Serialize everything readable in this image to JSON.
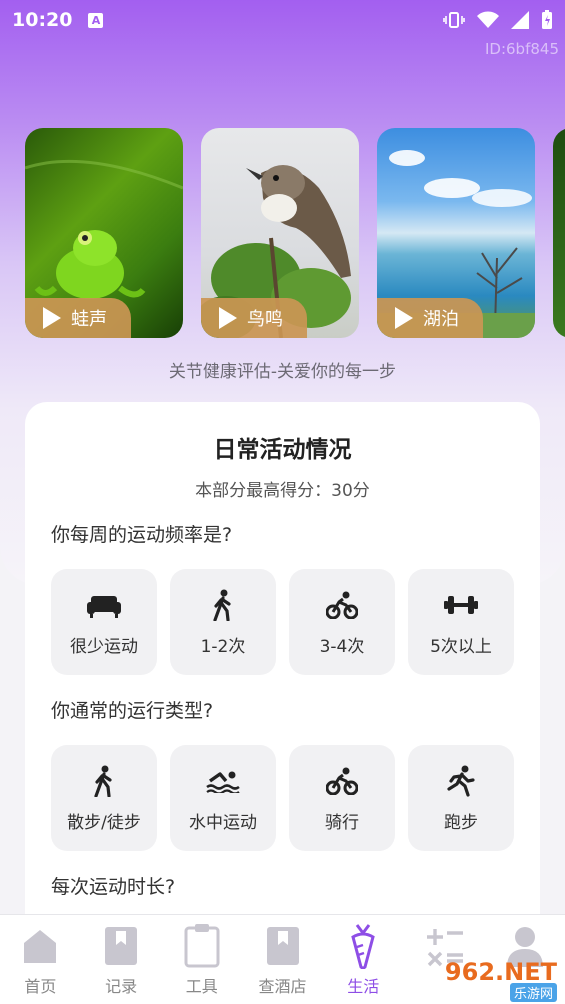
{
  "status": {
    "time": "10:20",
    "app_badge": "A"
  },
  "id_label": "ID:6bf845",
  "cards": [
    {
      "label": "蛙声",
      "image": "frog-image"
    },
    {
      "label": "鸟鸣",
      "image": "bird-image"
    },
    {
      "label": "湖泊",
      "image": "lake-image"
    }
  ],
  "tagline": "关节健康评估-关爱你的每一步",
  "panel": {
    "title": "日常活动情况",
    "subtitle": "本部分最高得分：30分",
    "q1": {
      "text": "你每周的运动频率是?",
      "options": [
        {
          "label": "很少运动",
          "icon": "sofa-icon"
        },
        {
          "label": "1-2次",
          "icon": "walk-icon"
        },
        {
          "label": "3-4次",
          "icon": "bike-icon"
        },
        {
          "label": "5次以上",
          "icon": "dumbbell-icon"
        }
      ]
    },
    "q2": {
      "text": "你通常的运行类型?",
      "options": [
        {
          "label": "散步/徒步",
          "icon": "walk-icon"
        },
        {
          "label": "水中运动",
          "icon": "swim-icon"
        },
        {
          "label": "骑行",
          "icon": "bike-icon"
        },
        {
          "label": "跑步",
          "icon": "run-icon"
        }
      ]
    },
    "q3": {
      "text": "每次运动时长?"
    }
  },
  "tabs": [
    {
      "label": "首页",
      "icon": "home-icon"
    },
    {
      "label": "记录",
      "icon": "bookmark-icon"
    },
    {
      "label": "工具",
      "icon": "clipboard-icon"
    },
    {
      "label": "查酒店",
      "icon": "hotel-icon"
    },
    {
      "label": "生活",
      "icon": "carrot-icon",
      "active": true
    },
    {
      "label": "",
      "icon": "calculator-icon"
    },
    {
      "label": "",
      "icon": "user-icon"
    }
  ],
  "watermark": {
    "text": "962.NET",
    "sub": "乐游网"
  },
  "colors": {
    "accent": "#8e4ee6",
    "play_button": "#cb9654"
  }
}
